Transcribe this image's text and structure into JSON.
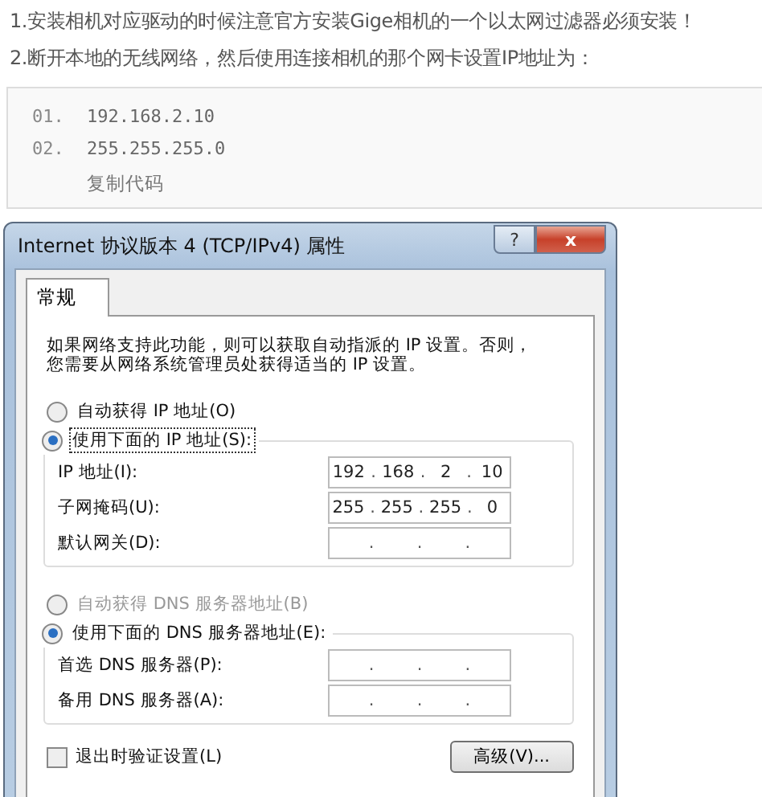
{
  "article": {
    "paragraphs": [
      "1.安装相机对应驱动的时候注意官方安装Gige相机的一个以太网过滤器必须安装！",
      "2.断开本地的无线网络，然后使用连接相机的那个网卡设置IP地址为："
    ]
  },
  "code_block": {
    "lines": [
      {
        "number": "01.",
        "code": "192.168.2.10"
      },
      {
        "number": "02.",
        "code": "255.255.255.0"
      }
    ],
    "copy_link": "复制代码"
  },
  "dialog": {
    "title": "Internet 协议版本 4 (TCP/IPv4) 属性",
    "help_button": "?",
    "close_button": "x",
    "tabs": [
      {
        "label": "常规",
        "selected": true
      }
    ],
    "description_lines": [
      "如果网络支持此功能，则可以获取自动指派的 IP 设置。否则，",
      "您需要从网络系统管理员处获得适当的 IP 设置。"
    ],
    "separator": ".",
    "sections": [
      {
        "auto_option": {
          "label": "自动获得 IP 地址(O)",
          "selected": false,
          "disabled": false,
          "focused": false
        },
        "manual_option": {
          "label": "使用下面的 IP 地址(S):",
          "selected": true,
          "disabled": false,
          "focused": true
        },
        "fields": [
          {
            "label": "IP 地址(I):",
            "octets": [
              "192",
              "168",
              "2",
              "10"
            ]
          },
          {
            "label": "子网掩码(U):",
            "octets": [
              "255",
              "255",
              "255",
              "0"
            ]
          },
          {
            "label": "默认网关(D):"
          }
        ]
      },
      {
        "auto_option": {
          "label": "自动获得 DNS 服务器地址(B)",
          "selected": false,
          "disabled": true,
          "focused": false
        },
        "manual_option": {
          "label": "使用下面的 DNS 服务器地址(E):",
          "selected": true,
          "disabled": false,
          "focused": false
        },
        "fields": [
          {
            "label": "首选 DNS 服务器(P):"
          },
          {
            "label": "备用 DNS 服务器(A):"
          }
        ]
      }
    ],
    "validate_checkbox": {
      "label": "退出时验证设置(L)",
      "checked": false
    },
    "advanced_button": "高级(V)..."
  }
}
